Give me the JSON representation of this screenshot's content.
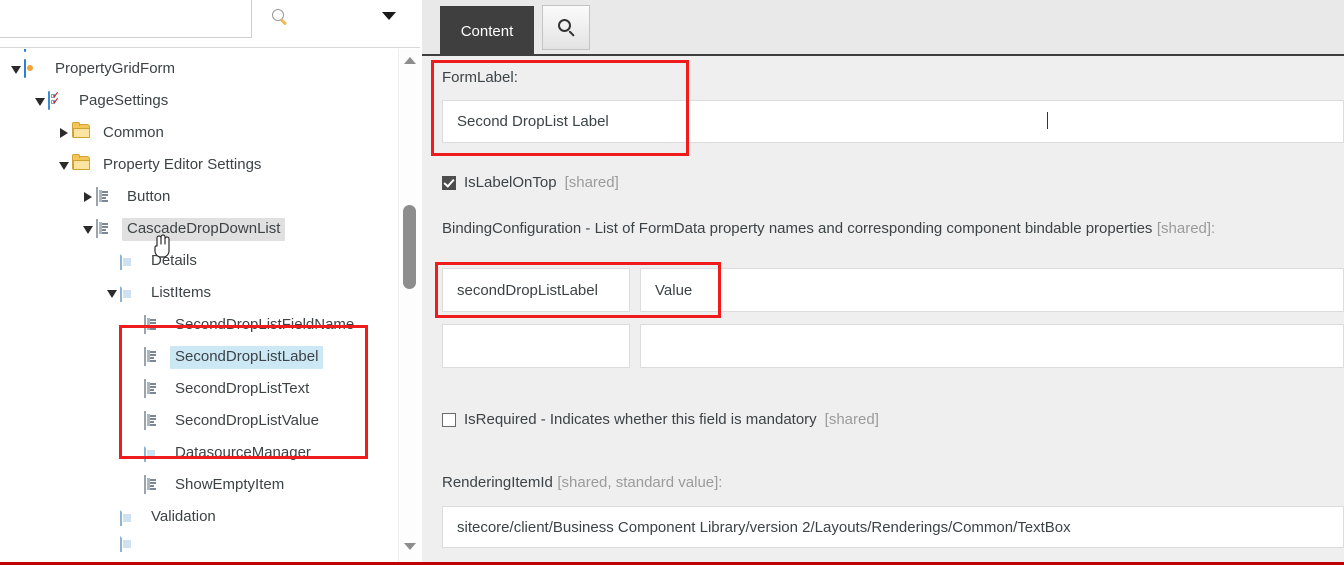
{
  "search": {
    "value": "",
    "placeholder": "",
    "search_icon": "search-icon",
    "dropdown_icon": "chevron-down-icon"
  },
  "tree": {
    "items": [
      {
        "label": "",
        "level": 0,
        "twisty": "none",
        "icon": "form-icon",
        "state": "clipped"
      },
      {
        "label": "PropertyGridForm",
        "level": 0,
        "twisty": "expanded",
        "icon": "form-icon",
        "state": "normal"
      },
      {
        "label": "PageSettings",
        "level": 1,
        "twisty": "expanded",
        "icon": "checklist-icon",
        "state": "normal"
      },
      {
        "label": "Common",
        "level": 2,
        "twisty": "collapsed",
        "icon": "folder-icon",
        "state": "normal"
      },
      {
        "label": "Property Editor Settings",
        "level": 2,
        "twisty": "expanded",
        "icon": "folder-icon",
        "state": "normal"
      },
      {
        "label": "Button",
        "level": 3,
        "twisty": "collapsed",
        "icon": "field-icon",
        "state": "normal"
      },
      {
        "label": "CascadeDropDownList",
        "level": 3,
        "twisty": "expanded",
        "icon": "field-icon",
        "state": "hover"
      },
      {
        "label": "Details",
        "level": 4,
        "twisty": "none",
        "icon": "doc-icon",
        "state": "normal"
      },
      {
        "label": "ListItems",
        "level": 4,
        "twisty": "expanded",
        "icon": "doc-icon",
        "state": "normal"
      },
      {
        "label": "SecondDropListFieldName",
        "level": 5,
        "twisty": "none",
        "icon": "field-icon",
        "state": "normal"
      },
      {
        "label": "SecondDropListLabel",
        "level": 5,
        "twisty": "none",
        "icon": "field-icon",
        "state": "selected"
      },
      {
        "label": "SecondDropListText",
        "level": 5,
        "twisty": "none",
        "icon": "field-icon",
        "state": "normal"
      },
      {
        "label": "SecondDropListValue",
        "level": 5,
        "twisty": "none",
        "icon": "field-icon",
        "state": "normal"
      },
      {
        "label": "DatasourceManager",
        "level": 5,
        "twisty": "none",
        "icon": "doc-icon",
        "state": "normal"
      },
      {
        "label": "ShowEmptyItem",
        "level": 5,
        "twisty": "none",
        "icon": "field-icon",
        "state": "normal"
      },
      {
        "label": "Validation",
        "level": 4,
        "twisty": "none",
        "icon": "doc-icon",
        "state": "normal"
      },
      {
        "label": "",
        "level": 4,
        "twisty": "none",
        "icon": "doc-icon",
        "state": "clipped"
      }
    ],
    "scrollbar": {
      "up_icon": "scroll-up-arrow",
      "down_icon": "scroll-down-arrow"
    }
  },
  "right_panel": {
    "tabs": [
      {
        "label": "Content",
        "name": "tab-content",
        "active": true
      },
      {
        "label": "",
        "name": "tab-search",
        "icon": "search-icon",
        "active": false
      }
    ],
    "fields": {
      "form_label": {
        "label": "FormLabel:",
        "value": "Second DropList Label",
        "placeholder": ""
      },
      "is_label_on_top": {
        "label": "IsLabelOnTop",
        "suffix": "[shared]",
        "checked": true
      },
      "binding_configuration": {
        "label": "BindingConfiguration - List of FormData property names and corresponding component bindable properties",
        "suffix": "[shared]:",
        "rows": [
          {
            "name": "secondDropListLabel",
            "value": "Value"
          },
          {
            "name": "",
            "value": ""
          }
        ],
        "placeholder": ""
      },
      "is_required": {
        "label": "IsRequired - Indicates whether this field is mandatory",
        "suffix": "[shared]",
        "checked": false
      },
      "rendering_item_id": {
        "label": "RenderingItemId",
        "suffix": "[shared, standard value]:",
        "value": "sitecore/client/Business Component Library/version 2/Layouts/Renderings/Common/TextBox",
        "placeholder": ""
      }
    }
  },
  "annotations": {
    "accent_color": "#ee1c1c",
    "boxes": [
      "formlabel-highlight",
      "binding-row-highlight",
      "tree-items-highlight"
    ]
  }
}
